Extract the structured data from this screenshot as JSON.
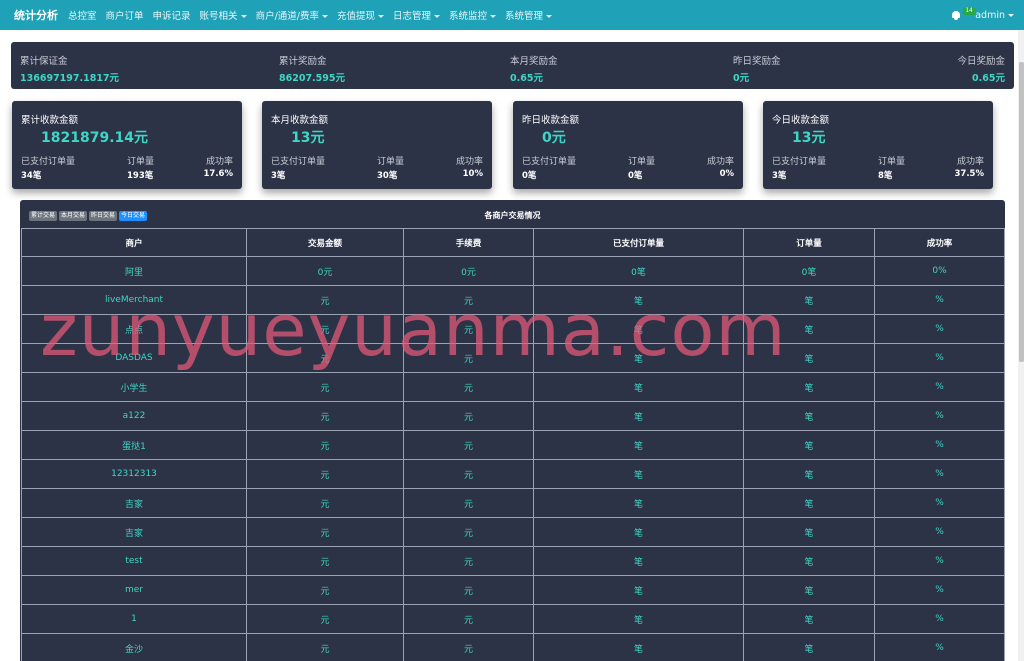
{
  "nav": {
    "brand": "统计分析",
    "items": [
      {
        "label": "总控室",
        "dropdown": false
      },
      {
        "label": "商户订单",
        "dropdown": false
      },
      {
        "label": "申诉记录",
        "dropdown": false
      },
      {
        "label": "账号相关",
        "dropdown": true
      },
      {
        "label": "商户/通道/费率",
        "dropdown": true
      },
      {
        "label": "充值提现",
        "dropdown": true
      },
      {
        "label": "日志管理",
        "dropdown": true
      },
      {
        "label": "系统监控",
        "dropdown": true
      },
      {
        "label": "系统管理",
        "dropdown": true
      }
    ],
    "notification_count": "14",
    "user": "admin"
  },
  "summary": [
    {
      "label": "累计保证金",
      "value": "136697197.1817元"
    },
    {
      "label": "累计奖励金",
      "value": "86207.595元"
    },
    {
      "label": "本月奖励金",
      "value": "0.65元"
    },
    {
      "label": "昨日奖励金",
      "value": "0元"
    },
    {
      "label": "今日奖励金",
      "value": "0.65元"
    }
  ],
  "cards": [
    {
      "title": "累计收款金额",
      "amount": "1821879.14元",
      "paid_label": "已支付订单量",
      "paid": "34笔",
      "orders_label": "订单量",
      "orders": "193笔",
      "rate_label": "成功率",
      "rate": "17.6%"
    },
    {
      "title": "本月收款金额",
      "amount": "13元",
      "paid_label": "已支付订单量",
      "paid": "3笔",
      "orders_label": "订单量",
      "orders": "30笔",
      "rate_label": "成功率",
      "rate": "10%"
    },
    {
      "title": "昨日收款金额",
      "amount": "0元",
      "paid_label": "已支付订单量",
      "paid": "0笔",
      "orders_label": "订单量",
      "orders": "0笔",
      "rate_label": "成功率",
      "rate": "0%"
    },
    {
      "title": "今日收款金额",
      "amount": "13元",
      "paid_label": "已支付订单量",
      "paid": "3笔",
      "orders_label": "订单量",
      "orders": "8笔",
      "rate_label": "成功率",
      "rate": "37.5%"
    }
  ],
  "panel": {
    "title": "各商户交易情况",
    "tabs": [
      "累计交易",
      "本月交易",
      "昨日交易",
      "今日交易"
    ],
    "active_tab": "今日交易"
  },
  "table": {
    "headers": [
      "商户",
      "交易金额",
      "手续费",
      "已支付订单量",
      "订单量",
      "成功率"
    ],
    "rows": [
      [
        "阿里",
        "0元",
        "0元",
        "0笔",
        "0笔",
        "0%"
      ],
      [
        "liveMerchant",
        "元",
        "元",
        "笔",
        "笔",
        "%"
      ],
      [
        "点点",
        "元",
        "元",
        "笔",
        "笔",
        "%"
      ],
      [
        "DASDAS",
        "元",
        "元",
        "笔",
        "笔",
        "%"
      ],
      [
        "小学生",
        "元",
        "元",
        "笔",
        "笔",
        "%"
      ],
      [
        "a122",
        "元",
        "元",
        "笔",
        "笔",
        "%"
      ],
      [
        "蛋挞1",
        "元",
        "元",
        "笔",
        "笔",
        "%"
      ],
      [
        "12312313",
        "元",
        "元",
        "笔",
        "笔",
        "%"
      ],
      [
        "吉家",
        "元",
        "元",
        "笔",
        "笔",
        "%"
      ],
      [
        "吉家",
        "元",
        "元",
        "笔",
        "笔",
        "%"
      ],
      [
        "test",
        "元",
        "元",
        "笔",
        "笔",
        "%"
      ],
      [
        "mer",
        "元",
        "元",
        "笔",
        "笔",
        "%"
      ],
      [
        "1",
        "元",
        "元",
        "笔",
        "笔",
        "%"
      ],
      [
        "金沙",
        "元",
        "元",
        "笔",
        "笔",
        "%"
      ]
    ]
  },
  "watermark": "zunyueyuanma.com",
  "colors": {
    "topbar": "#1fa2b8",
    "panel": "#2c3347",
    "accent": "#3ed6c5",
    "watermark": "#e85a78"
  }
}
